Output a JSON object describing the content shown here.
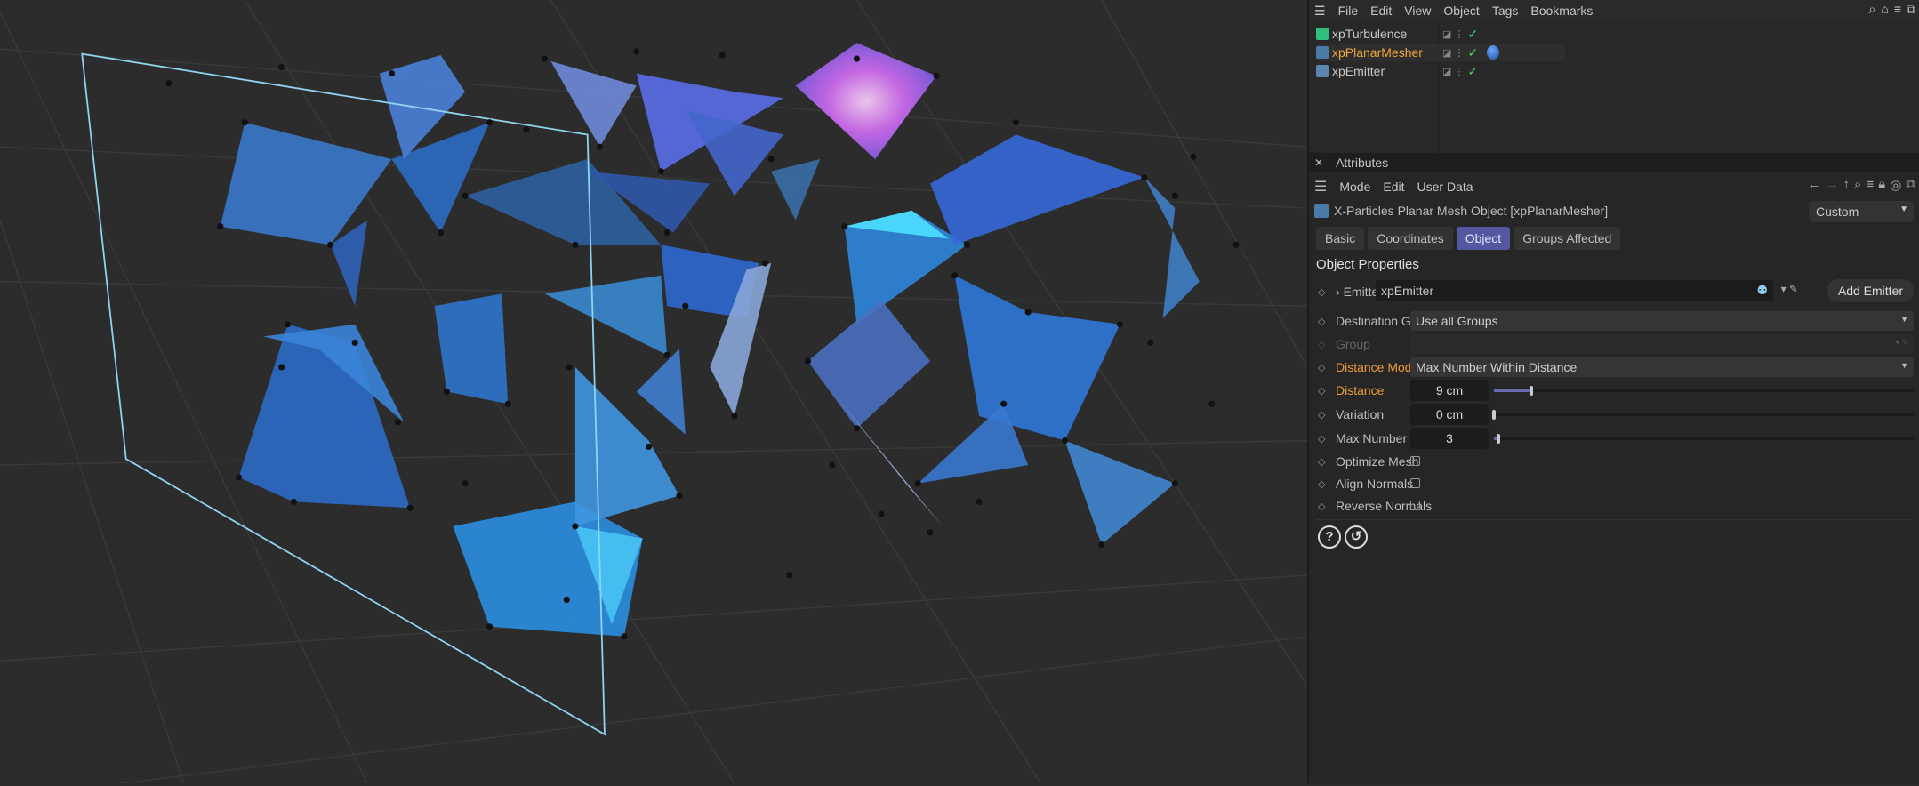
{
  "menu": {
    "items": [
      "File",
      "Edit",
      "View",
      "Object",
      "Tags",
      "Bookmarks"
    ]
  },
  "objects": [
    {
      "name": "xpTurbulence",
      "color": "#c8c8c8",
      "icon": "turbulence-icon"
    },
    {
      "name": "xpPlanarMesher",
      "color": "#f0a93c",
      "icon": "planar-mesher-icon",
      "tag": "material-tag"
    },
    {
      "name": "xpEmitter",
      "color": "#c8c8c8",
      "icon": "emitter-icon"
    }
  ],
  "attributes": {
    "panel_title": "Attributes",
    "mode_menu": [
      "Mode",
      "Edit",
      "User Data"
    ],
    "object_title": "X-Particles Planar Mesh Object [xpPlanarMesher]",
    "preset": "Custom",
    "tabs": [
      "Basic",
      "Coordinates",
      "Object",
      "Groups Affected"
    ],
    "active_tab": "Object",
    "section": "Object Properties",
    "emitter": {
      "label": "Emitter",
      "value": "xpEmitter",
      "button": "Add Emitter"
    },
    "destination_group": {
      "label": "Destination Group",
      "value": "Use all Groups"
    },
    "group": {
      "label": "Group",
      "value": ""
    },
    "distance_mode": {
      "label": "Distance Mode",
      "value": "Max Number Within Distance"
    },
    "distance": {
      "label": "Distance",
      "value": "9 cm",
      "slider_fraction": 0.09
    },
    "variation": {
      "label": "Variation",
      "value": "0 cm",
      "slider_fraction": 0
    },
    "max_number": {
      "label": "Max Number",
      "value": "3",
      "slider_fraction": 0.01
    },
    "optimize_mesh": {
      "label": "Optimize Mesh",
      "checked": false
    },
    "align_normals": {
      "label": "Align Normals",
      "checked": false
    },
    "reverse_normals": {
      "label": "Reverse Normals",
      "checked": false
    }
  },
  "colors": {
    "accent": "#5458a0",
    "highlight_label": "#ef9b3c",
    "check": "#4bd26a"
  }
}
